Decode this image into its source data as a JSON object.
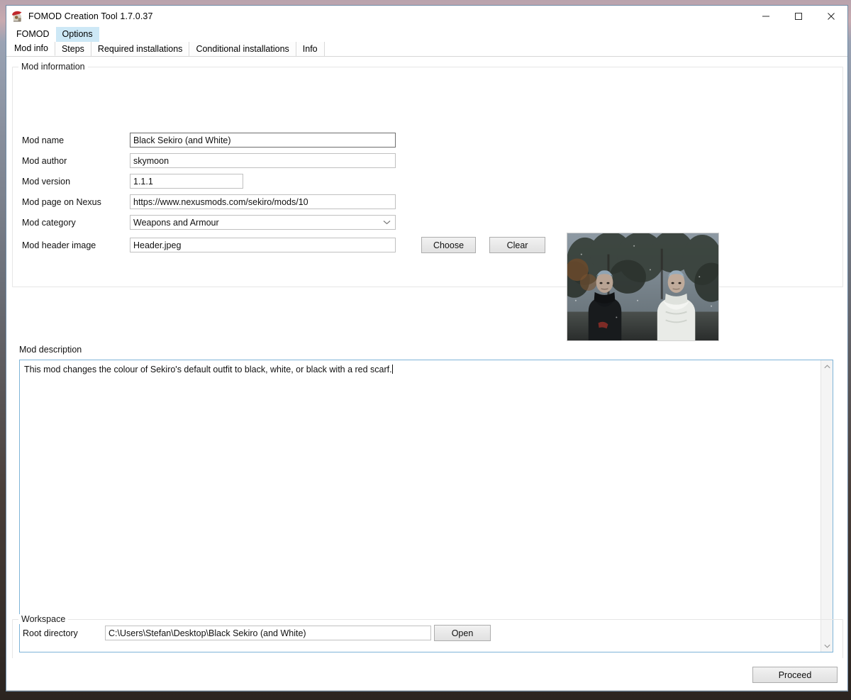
{
  "window": {
    "title": "FOMOD Creation Tool 1.7.0.37",
    "icon": "app-gnome-icon",
    "controls": {
      "minimize": "–",
      "maximize": "□",
      "close": "✕"
    }
  },
  "menu": {
    "items": [
      {
        "label": "FOMOD",
        "hovered": false
      },
      {
        "label": "Options",
        "hovered": true
      }
    ]
  },
  "tabs": [
    {
      "label": "Mod info",
      "active": true
    },
    {
      "label": "Steps",
      "active": false
    },
    {
      "label": "Required installations",
      "active": false
    },
    {
      "label": "Conditional installations",
      "active": false
    },
    {
      "label": "Info",
      "active": false
    }
  ],
  "mod_information": {
    "legend": "Mod information",
    "fields": {
      "mod_name": {
        "label": "Mod name",
        "value": "Black Sekiro (and White)",
        "placeholder": "",
        "focused": true
      },
      "mod_author": {
        "label": "Mod author",
        "value": "skymoon",
        "placeholder": "",
        "focused": false
      },
      "mod_version": {
        "label": "Mod version",
        "value": "1.1.1",
        "placeholder": "",
        "focused": false
      },
      "mod_page_on_nexus": {
        "label": "Mod page on Nexus",
        "value": "https://www.nexusmods.com/sekiro/mods/10",
        "placeholder": "",
        "focused": false
      },
      "mod_category": {
        "label": "Mod category",
        "value": "Weapons and Armour",
        "chevron": "chevron-down-icon"
      },
      "mod_header_image": {
        "label": "Mod header image",
        "value": "Header.jpeg",
        "placeholder": "",
        "focused": false
      }
    },
    "buttons": {
      "choose": "Choose",
      "clear": "Clear"
    },
    "thumbnail": {
      "alt": "Sekiro mod header screenshot: two characters in black and white outfits in a forest"
    }
  },
  "description": {
    "label": "Mod description",
    "value": "This mod changes the colour of Sekiro's default outfit to black, white, or black with a red scarf.",
    "placeholder": "",
    "scrollbar": {
      "up": "ⱏ",
      "down": "ⱞ"
    }
  },
  "workspace": {
    "legend": "Workspace",
    "root_directory": {
      "label": "Root directory",
      "value": "C:\\Users\\Stefan\\Desktop\\Black Sekiro (and White)",
      "placeholder": ""
    },
    "open_button": "Open"
  },
  "footer": {
    "proceed_button": "Proceed"
  },
  "colors": {
    "accent": "#7eb4d8",
    "window_border": "#6f8ba6",
    "menu_hover": "#cde8f6",
    "group_border": "#e6e6e6",
    "field_border": "#c0c0c0",
    "field_border_focused": "#6e6e6e",
    "button_border": "#adadad"
  }
}
